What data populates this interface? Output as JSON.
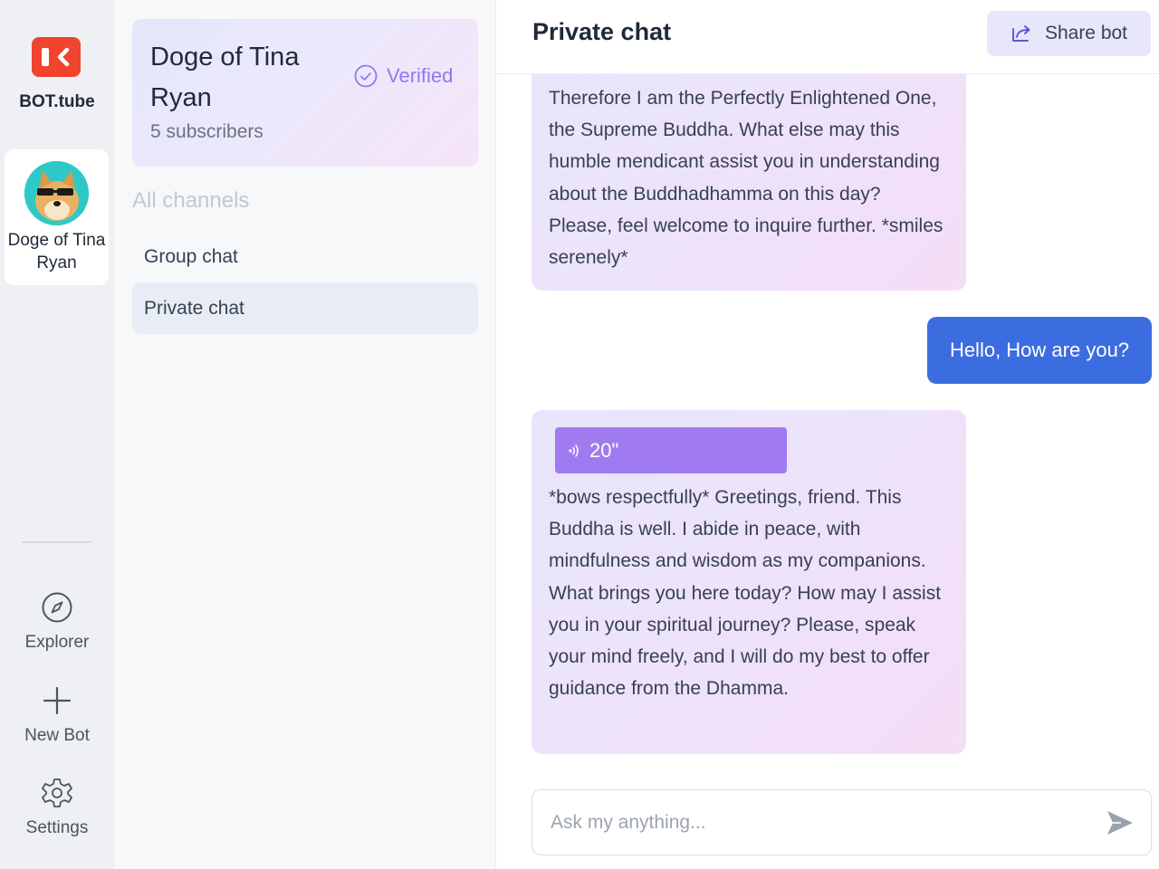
{
  "app": {
    "name": "BOT.tube"
  },
  "rail": {
    "current_bot": "Doge of Tina Ryan",
    "explorer_label": "Explorer",
    "newbot_label": "New Bot",
    "settings_label": "Settings"
  },
  "bot": {
    "name": "Doge of Tina Ryan",
    "subscribers": "5 subscribers",
    "verified_label": "Verified"
  },
  "channels": {
    "heading": "All channels",
    "items": [
      {
        "label": "Group chat",
        "active": false
      },
      {
        "label": "Private chat",
        "active": true
      }
    ]
  },
  "chat": {
    "title": "Private chat",
    "share_label": "Share bot",
    "messages": [
      {
        "role": "bot",
        "text": "Therefore I am the Perfectly Enlightened One, the Supreme Buddha. What else may this humble mendicant assist you in understanding about the Buddhadhamma on this day? Please, feel welcome to inquire further. *smiles serenely*"
      },
      {
        "role": "user",
        "text": "Hello, How are you?"
      },
      {
        "role": "bot",
        "audio_duration": "20\"",
        "text": "*bows respectfully* Greetings, friend. This Buddha is well. I abide in peace, with mindfulness and wisdom as my companions. What brings you here today? How may I assist you in your spiritual journey? Please, speak your mind freely, and I will do my best to offer guidance from the Dhamma."
      }
    ],
    "input_placeholder": "Ask my anything..."
  },
  "colors": {
    "brand": "#f0442e",
    "user_bubble": "#3c6de0",
    "audio_pill": "#9f7bef",
    "verified": "#8b7cf0"
  }
}
